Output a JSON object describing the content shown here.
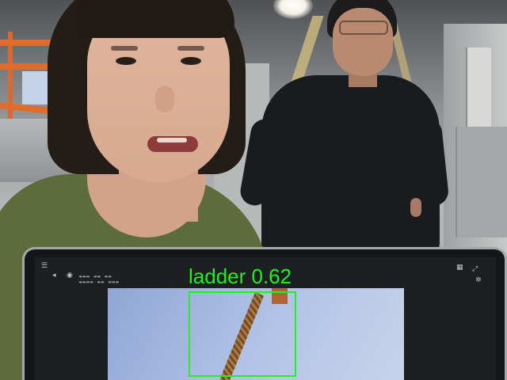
{
  "detection": {
    "label": "ladder 0.62",
    "color": "#1ff21f"
  },
  "icons": {
    "laptop_left": [
      "menu-icon",
      "arrow-icon",
      "record-icon"
    ],
    "laptop_right": [
      "grid-icon",
      "expand-icon",
      "settings-icon"
    ]
  }
}
